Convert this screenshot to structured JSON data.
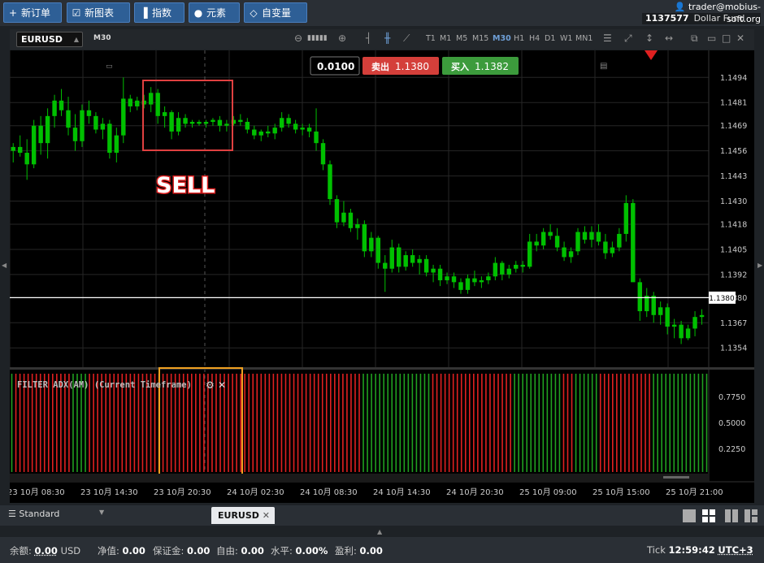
{
  "toolbar": {
    "new_order": "新订单",
    "new_chart": "新图表",
    "indicators": "指数",
    "elements": "元素",
    "custom_vars": "自变量"
  },
  "account": {
    "email": "trader@mobius-soft.org",
    "number": "1137577",
    "fund": "Dollar Fund"
  },
  "chart_bar": {
    "symbol": "EURUSD",
    "timeframe": "M30",
    "timeframes": [
      "T1",
      "M1",
      "M5",
      "M15",
      "M30",
      "H1",
      "H4",
      "D1",
      "W1",
      "MN1"
    ],
    "active_timeframe": "M30"
  },
  "trade_panel": {
    "lot": "0.0100",
    "sell_label": "卖出",
    "sell_price": "1.1380",
    "buy_label": "买入",
    "buy_price": "1.1382"
  },
  "annotation": {
    "text": "SELL"
  },
  "colors": {
    "bull": "#00c000",
    "bear": "#00c000",
    "sell": "#d43f3a",
    "buy": "#3c9b3c",
    "red_box": "#e04040",
    "orange_box": "#f0a020",
    "adx_red": "#e02020",
    "adx_green": "#20a020",
    "price_line": "#ffffff"
  },
  "indicator": {
    "title": "FILTER ADX(AM) (Current Timeframe)",
    "levels": [
      "0.7750",
      "0.5000",
      "0.2250"
    ]
  },
  "chart_data": {
    "type": "candlestick",
    "symbol": "EURUSD",
    "timeframe": "M30",
    "y_ticks": [
      "1.1494",
      "1.1481",
      "1.1469",
      "1.1456",
      "1.1443",
      "1.1430",
      "1.1418",
      "1.1405",
      "1.1392",
      "1.1380",
      "1.1367",
      "1.1354"
    ],
    "x_ticks": [
      "23 10月 08:30",
      "23 10月 14:30",
      "23 10月 20:30",
      "24 10月 02:30",
      "24 10月 08:30",
      "24 10月 14:30",
      "24 10月 20:30",
      "25 10月 09:00",
      "25 10月 15:00",
      "25 10月 21:00"
    ],
    "current_price": 1.138,
    "current_price_label": "1.1380",
    "ylim": [
      1.1344,
      1.1508
    ],
    "candles": [
      {
        "o": 1.1456,
        "h": 1.146,
        "l": 1.145,
        "c": 1.1458
      },
      {
        "o": 1.1458,
        "h": 1.1464,
        "l": 1.1453,
        "c": 1.1455
      },
      {
        "o": 1.1455,
        "h": 1.1462,
        "l": 1.1441,
        "c": 1.1449
      },
      {
        "o": 1.1449,
        "h": 1.1472,
        "l": 1.1447,
        "c": 1.1469
      },
      {
        "o": 1.1469,
        "h": 1.1474,
        "l": 1.1454,
        "c": 1.146
      },
      {
        "o": 1.146,
        "h": 1.1478,
        "l": 1.1452,
        "c": 1.1474
      },
      {
        "o": 1.1474,
        "h": 1.1485,
        "l": 1.1468,
        "c": 1.1482
      },
      {
        "o": 1.1482,
        "h": 1.1488,
        "l": 1.1474,
        "c": 1.1477
      },
      {
        "o": 1.1477,
        "h": 1.1484,
        "l": 1.1464,
        "c": 1.1468
      },
      {
        "o": 1.1468,
        "h": 1.1475,
        "l": 1.1456,
        "c": 1.1461
      },
      {
        "o": 1.1461,
        "h": 1.148,
        "l": 1.1458,
        "c": 1.1477
      },
      {
        "o": 1.1477,
        "h": 1.1482,
        "l": 1.147,
        "c": 1.1474
      },
      {
        "o": 1.1474,
        "h": 1.1476,
        "l": 1.1465,
        "c": 1.1467
      },
      {
        "o": 1.1467,
        "h": 1.1473,
        "l": 1.1462,
        "c": 1.147
      },
      {
        "o": 1.147,
        "h": 1.1472,
        "l": 1.1452,
        "c": 1.1455
      },
      {
        "o": 1.1455,
        "h": 1.1468,
        "l": 1.145,
        "c": 1.1464
      },
      {
        "o": 1.1464,
        "h": 1.1494,
        "l": 1.146,
        "c": 1.1483
      },
      {
        "o": 1.1483,
        "h": 1.1485,
        "l": 1.1476,
        "c": 1.1479
      },
      {
        "o": 1.1479,
        "h": 1.1484,
        "l": 1.1477,
        "c": 1.1482
      },
      {
        "o": 1.1482,
        "h": 1.1485,
        "l": 1.1478,
        "c": 1.148
      },
      {
        "o": 1.148,
        "h": 1.1489,
        "l": 1.1476,
        "c": 1.1486
      },
      {
        "o": 1.1486,
        "h": 1.1488,
        "l": 1.147,
        "c": 1.1474
      },
      {
        "o": 1.1474,
        "h": 1.1479,
        "l": 1.1468,
        "c": 1.1476
      },
      {
        "o": 1.1476,
        "h": 1.1477,
        "l": 1.1462,
        "c": 1.1466
      },
      {
        "o": 1.1466,
        "h": 1.1476,
        "l": 1.1464,
        "c": 1.1473
      },
      {
        "o": 1.1473,
        "h": 1.1475,
        "l": 1.1468,
        "c": 1.147
      },
      {
        "o": 1.147,
        "h": 1.1472,
        "l": 1.1468,
        "c": 1.1471
      },
      {
        "o": 1.1471,
        "h": 1.1472,
        "l": 1.1469,
        "c": 1.147
      },
      {
        "o": 1.147,
        "h": 1.1472,
        "l": 1.1468,
        "c": 1.1471
      },
      {
        "o": 1.1471,
        "h": 1.1473,
        "l": 1.1469,
        "c": 1.1472
      },
      {
        "o": 1.1472,
        "h": 1.1474,
        "l": 1.1466,
        "c": 1.1469
      },
      {
        "o": 1.1469,
        "h": 1.1472,
        "l": 1.1466,
        "c": 1.147
      },
      {
        "o": 1.147,
        "h": 1.1474,
        "l": 1.1469,
        "c": 1.1472
      },
      {
        "o": 1.1472,
        "h": 1.1475,
        "l": 1.1469,
        "c": 1.1471
      },
      {
        "o": 1.1471,
        "h": 1.1473,
        "l": 1.1465,
        "c": 1.1467
      },
      {
        "o": 1.1467,
        "h": 1.1469,
        "l": 1.1462,
        "c": 1.1464
      },
      {
        "o": 1.1464,
        "h": 1.1467,
        "l": 1.1461,
        "c": 1.1466
      },
      {
        "o": 1.1466,
        "h": 1.1469,
        "l": 1.1463,
        "c": 1.1465
      },
      {
        "o": 1.1465,
        "h": 1.147,
        "l": 1.1462,
        "c": 1.1468
      },
      {
        "o": 1.1468,
        "h": 1.1476,
        "l": 1.1466,
        "c": 1.1473
      },
      {
        "o": 1.1473,
        "h": 1.1475,
        "l": 1.1468,
        "c": 1.147
      },
      {
        "o": 1.147,
        "h": 1.1472,
        "l": 1.1465,
        "c": 1.1467
      },
      {
        "o": 1.1467,
        "h": 1.147,
        "l": 1.1464,
        "c": 1.1468
      },
      {
        "o": 1.1468,
        "h": 1.147,
        "l": 1.1463,
        "c": 1.1466
      },
      {
        "o": 1.1466,
        "h": 1.1478,
        "l": 1.1456,
        "c": 1.146
      },
      {
        "o": 1.146,
        "h": 1.1462,
        "l": 1.1446,
        "c": 1.1449
      },
      {
        "o": 1.1449,
        "h": 1.1451,
        "l": 1.1428,
        "c": 1.1431
      },
      {
        "o": 1.1431,
        "h": 1.1433,
        "l": 1.1416,
        "c": 1.1419
      },
      {
        "o": 1.1419,
        "h": 1.143,
        "l": 1.1417,
        "c": 1.1424
      },
      {
        "o": 1.1424,
        "h": 1.1426,
        "l": 1.1414,
        "c": 1.1416
      },
      {
        "o": 1.1416,
        "h": 1.1421,
        "l": 1.141,
        "c": 1.1418
      },
      {
        "o": 1.1418,
        "h": 1.142,
        "l": 1.1401,
        "c": 1.1404
      },
      {
        "o": 1.1404,
        "h": 1.1414,
        "l": 1.1401,
        "c": 1.1411
      },
      {
        "o": 1.1411,
        "h": 1.1412,
        "l": 1.1395,
        "c": 1.1398
      },
      {
        "o": 1.1398,
        "h": 1.1402,
        "l": 1.1383,
        "c": 1.1395
      },
      {
        "o": 1.1395,
        "h": 1.141,
        "l": 1.1393,
        "c": 1.1406
      },
      {
        "o": 1.1406,
        "h": 1.1408,
        "l": 1.1393,
        "c": 1.1396
      },
      {
        "o": 1.1396,
        "h": 1.1404,
        "l": 1.1394,
        "c": 1.1402
      },
      {
        "o": 1.1402,
        "h": 1.1405,
        "l": 1.1396,
        "c": 1.1398
      },
      {
        "o": 1.1398,
        "h": 1.1402,
        "l": 1.1392,
        "c": 1.14
      },
      {
        "o": 1.14,
        "h": 1.1402,
        "l": 1.1391,
        "c": 1.1393
      },
      {
        "o": 1.1393,
        "h": 1.1397,
        "l": 1.1388,
        "c": 1.1395
      },
      {
        "o": 1.1395,
        "h": 1.1397,
        "l": 1.1386,
        "c": 1.1389
      },
      {
        "o": 1.1389,
        "h": 1.1393,
        "l": 1.1387,
        "c": 1.1391
      },
      {
        "o": 1.1391,
        "h": 1.1393,
        "l": 1.1385,
        "c": 1.1388
      },
      {
        "o": 1.1388,
        "h": 1.139,
        "l": 1.1382,
        "c": 1.1384
      },
      {
        "o": 1.1384,
        "h": 1.1392,
        "l": 1.1382,
        "c": 1.139
      },
      {
        "o": 1.139,
        "h": 1.1394,
        "l": 1.1386,
        "c": 1.1388
      },
      {
        "o": 1.1388,
        "h": 1.1391,
        "l": 1.1385,
        "c": 1.1389
      },
      {
        "o": 1.1389,
        "h": 1.1393,
        "l": 1.1387,
        "c": 1.1391
      },
      {
        "o": 1.1391,
        "h": 1.1401,
        "l": 1.1389,
        "c": 1.1398
      },
      {
        "o": 1.1398,
        "h": 1.1399,
        "l": 1.1389,
        "c": 1.1392
      },
      {
        "o": 1.1392,
        "h": 1.1397,
        "l": 1.139,
        "c": 1.1395
      },
      {
        "o": 1.1395,
        "h": 1.1399,
        "l": 1.1393,
        "c": 1.1397
      },
      {
        "o": 1.1397,
        "h": 1.1399,
        "l": 1.1393,
        "c": 1.1396
      },
      {
        "o": 1.1396,
        "h": 1.1413,
        "l": 1.1395,
        "c": 1.1409
      },
      {
        "o": 1.1409,
        "h": 1.1413,
        "l": 1.1404,
        "c": 1.1407
      },
      {
        "o": 1.1407,
        "h": 1.1416,
        "l": 1.1405,
        "c": 1.1414
      },
      {
        "o": 1.1414,
        "h": 1.1418,
        "l": 1.141,
        "c": 1.1412
      },
      {
        "o": 1.1412,
        "h": 1.1416,
        "l": 1.1404,
        "c": 1.1406
      },
      {
        "o": 1.1406,
        "h": 1.1409,
        "l": 1.1399,
        "c": 1.1401
      },
      {
        "o": 1.1401,
        "h": 1.1406,
        "l": 1.1398,
        "c": 1.1404
      },
      {
        "o": 1.1404,
        "h": 1.1416,
        "l": 1.1402,
        "c": 1.1414
      },
      {
        "o": 1.1414,
        "h": 1.1417,
        "l": 1.1408,
        "c": 1.141
      },
      {
        "o": 1.141,
        "h": 1.1417,
        "l": 1.1406,
        "c": 1.1414
      },
      {
        "o": 1.1414,
        "h": 1.1418,
        "l": 1.1407,
        "c": 1.1409
      },
      {
        "o": 1.1409,
        "h": 1.1413,
        "l": 1.14,
        "c": 1.1403
      },
      {
        "o": 1.1403,
        "h": 1.1409,
        "l": 1.1401,
        "c": 1.1406
      },
      {
        "o": 1.1406,
        "h": 1.1416,
        "l": 1.1404,
        "c": 1.1413
      },
      {
        "o": 1.1413,
        "h": 1.1433,
        "l": 1.1409,
        "c": 1.1429
      },
      {
        "o": 1.1429,
        "h": 1.1431,
        "l": 1.1394,
        "c": 1.1388
      },
      {
        "o": 1.1388,
        "h": 1.139,
        "l": 1.1368,
        "c": 1.1373
      },
      {
        "o": 1.1373,
        "h": 1.1385,
        "l": 1.137,
        "c": 1.1381
      },
      {
        "o": 1.1381,
        "h": 1.1383,
        "l": 1.1367,
        "c": 1.1371
      },
      {
        "o": 1.1371,
        "h": 1.1378,
        "l": 1.1366,
        "c": 1.1375
      },
      {
        "o": 1.1375,
        "h": 1.1377,
        "l": 1.1361,
        "c": 1.1365
      },
      {
        "o": 1.1365,
        "h": 1.1369,
        "l": 1.1359,
        "c": 1.1366
      },
      {
        "o": 1.1366,
        "h": 1.1368,
        "l": 1.1356,
        "c": 1.1359
      },
      {
        "o": 1.1359,
        "h": 1.1366,
        "l": 1.1358,
        "c": 1.1364
      },
      {
        "o": 1.1364,
        "h": 1.1373,
        "l": 1.136,
        "c": 1.137
      },
      {
        "o": 1.137,
        "h": 1.1374,
        "l": 1.1366,
        "c": 1.1371
      }
    ],
    "adx_bars": "GRRRRRRRRRRRRRRGGGGRRRRRRRRRRRRRRRRRRRRRRRRRRRRRRRRRRRRRRRRRRRRRRRRRRRRRRRRRRRRRRRRRRRGGGGGGGGGGGGGGGGGRRRRRRRRRRRRRRRRRRRRGGGGGGGGGGGGRRRGGGGGGRRRRRRRRRRRRRGGGGGGGGGGGGGG"
  },
  "bottom_tabs": {
    "layout": "Standard",
    "symbol_tab": "EURUSD"
  },
  "status": {
    "balance_label": "余额:",
    "balance_value": "0.00",
    "balance_ccy": "USD",
    "equity_label": "净值:",
    "equity_value": "0.00",
    "margin_label": "保证金:",
    "margin_value": "0.00",
    "free_label": "自由:",
    "free_value": "0.00",
    "level_label": "水平:",
    "level_value": "0.00%",
    "profit_label": "盈利:",
    "profit_value": "0.00",
    "tick_label": "Tick",
    "time": "12:59:42",
    "tz": "UTC+3"
  }
}
